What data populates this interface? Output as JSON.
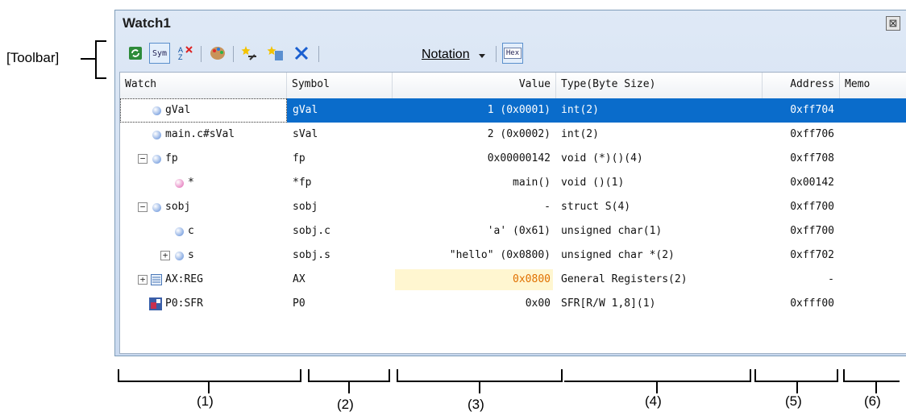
{
  "toolbar_label": "[Toolbar]",
  "window": {
    "title": "Watch1",
    "close_glyph": "⊠"
  },
  "toolbar": {
    "notation_label": "Notation",
    "buttons": [
      "refresh-icon",
      "sym-icon",
      "sort-az-icon",
      "color-palette-icon",
      "new-watch-icon",
      "new-category-icon",
      "delete-icon",
      "hex-icon"
    ],
    "sym_text": "Sym",
    "hex_text": "Hex"
  },
  "columns": {
    "watch": "Watch",
    "symbol": "Symbol",
    "value": "Value",
    "type": "Type(Byte Size)",
    "address": "Address",
    "memo": "Memo"
  },
  "rows": [
    {
      "watch": "gVal",
      "symbol": "gVal",
      "value": "1 (0x0001)",
      "type": "int(2)",
      "address": "0xff704",
      "selected": true
    },
    {
      "watch": "main.c#sVal",
      "symbol": "sVal",
      "value": "2 (0x0002)",
      "type": "int(2)",
      "address": "0xff706"
    },
    {
      "watch": "fp",
      "symbol": "fp",
      "value": "0x00000142",
      "type": "void (*)()(4)",
      "address": "0xff708"
    },
    {
      "watch": "*",
      "symbol": "*fp",
      "value": "main()",
      "type": "void ()(1)",
      "address": "0x00142"
    },
    {
      "watch": "sobj",
      "symbol": "sobj",
      "value": "-",
      "type": "struct S(4)",
      "address": "0xff700"
    },
    {
      "watch": "c",
      "symbol": "sobj.c",
      "value": "'a' (0x61)",
      "type": "unsigned char(1)",
      "address": "0xff700"
    },
    {
      "watch": "s",
      "symbol": "sobj.s",
      "value": "\"hello\" (0x0800)",
      "type": "unsigned char *(2)",
      "address": "0xff702"
    },
    {
      "watch": "AX:REG",
      "symbol": "AX",
      "value": "0x0800",
      "type": "General Registers(2)",
      "address": "-"
    },
    {
      "watch": "P0:SFR",
      "symbol": "P0",
      "value": "0x00",
      "type": "SFR[R/W 1,8](1)",
      "address": "0xfff00"
    }
  ],
  "callouts": [
    "(1)",
    "(2)",
    "(3)",
    "(4)",
    "(5)",
    "(6)"
  ],
  "colors": {
    "selection": "#0a6ccb",
    "changed_value": "#e07000",
    "changed_bg": "#fff6d0"
  }
}
